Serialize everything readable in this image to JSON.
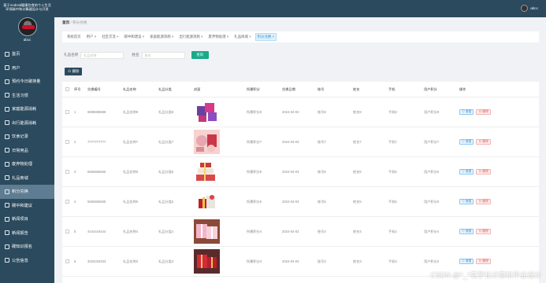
{
  "sidebar": {
    "title": "基于Android健康饮食的个人生活环保碳中和计算器设计与开发",
    "username": "abcc",
    "items": [
      {
        "label": "首页",
        "icon": "home-icon",
        "active": false
      },
      {
        "label": "用户",
        "icon": "user-icon",
        "active": false
      },
      {
        "label": "预约今日碳排量",
        "icon": "calendar-icon",
        "active": false
      },
      {
        "label": "生活习惯",
        "icon": "list-icon",
        "active": false
      },
      {
        "label": "家庭能源消耗",
        "icon": "home-energy-icon",
        "active": false
      },
      {
        "label": "出行能源消耗",
        "icon": "car-icon",
        "active": false
      },
      {
        "label": "饮食记录",
        "icon": "food-icon",
        "active": false
      },
      {
        "label": "日常用品",
        "icon": "bag-icon",
        "active": false
      },
      {
        "label": "废弃物处理",
        "icon": "trash-icon",
        "active": false
      },
      {
        "label": "礼品商城",
        "icon": "gift-icon",
        "active": false
      },
      {
        "label": "积分兑换",
        "icon": "exchange-icon",
        "active": true
      },
      {
        "label": "碳中和建议",
        "icon": "leaf-icon",
        "active": false
      },
      {
        "label": "新闻项目",
        "icon": "news-icon",
        "active": false
      },
      {
        "label": "新闻报告",
        "icon": "report-icon",
        "active": false
      },
      {
        "label": "碳知识报名",
        "icon": "signup-icon",
        "active": false
      },
      {
        "label": "公告信息",
        "icon": "notice-icon",
        "active": false
      }
    ]
  },
  "header": {
    "username": "abcc"
  },
  "breadcrumb": {
    "home": "首页",
    "current": "积分兑换"
  },
  "tags": [
    {
      "label": "系统首页",
      "active": false
    },
    {
      "label": "用户 ×",
      "active": false
    },
    {
      "label": "社区交流 ×",
      "active": false
    },
    {
      "label": "碳中和建议 ×",
      "active": false
    },
    {
      "label": "家庭能源消耗 ×",
      "active": false
    },
    {
      "label": "出行能源消耗 ×",
      "active": false
    },
    {
      "label": "废弃物处理 ×",
      "active": false
    },
    {
      "label": "礼品商城 ×",
      "active": false
    },
    {
      "label": "积分兑换 ×",
      "active": true
    }
  ],
  "search": {
    "label1": "礼品名称",
    "placeholder1": "礼品名称",
    "label2": "姓名",
    "placeholder2": "姓名",
    "button": "查询"
  },
  "delete_button": "删除",
  "table": {
    "headers": [
      "",
      "序号",
      "兑换编号",
      "礼品名称",
      "礼品分类",
      "封面",
      "所需积分",
      "兑换日期",
      "账号",
      "姓名",
      "手机",
      "用户积分",
      "操作"
    ],
    "view_label": "查看",
    "delete_label": "删除",
    "rows": [
      {
        "no": "1",
        "code": "8888888888",
        "name": "礼品名称8",
        "cat": "礼品分类8",
        "img": "purple",
        "points": "所需积分8",
        "date": "2024-04-03",
        "account": "账号8",
        "person": "姓名8",
        "phone": "手机8",
        "upoints": "用户积分8"
      },
      {
        "no": "2",
        "code": "7777777777",
        "name": "礼品名称7",
        "cat": "礼品分类7",
        "img": "pink",
        "points": "所需积分7",
        "date": "2024-04-03",
        "account": "账号7",
        "person": "姓名7",
        "phone": "手机7",
        "upoints": "用户积分7"
      },
      {
        "no": "3",
        "code": "6666666666",
        "name": "礼品名称6",
        "cat": "礼品分类6",
        "img": "stack",
        "points": "所需积分6",
        "date": "2024-04-03",
        "account": "账号6",
        "person": "姓名6",
        "phone": "手机6",
        "upoints": "用户积分6"
      },
      {
        "no": "4",
        "code": "5555555555",
        "name": "礼品名称5",
        "cat": "礼品分类5",
        "img": "red",
        "points": "所需积分5",
        "date": "2024-04-03",
        "account": "账号5",
        "person": "姓名5",
        "phone": "手机5",
        "upoints": "用户积分5"
      },
      {
        "no": "5",
        "code": "4444444444",
        "name": "礼品名称4",
        "cat": "礼品分类4",
        "img": "pinkbox",
        "points": "所需积分4",
        "date": "2024-04-03",
        "account": "账号4",
        "person": "姓名4",
        "phone": "手机4",
        "upoints": "用户积分4"
      },
      {
        "no": "6",
        "code": "3333333333",
        "name": "礼品名称3",
        "cat": "礼品分类3",
        "img": "redbox",
        "points": "所需积分3",
        "date": "2024-04-03",
        "account": "账号3",
        "person": "姓名3",
        "phone": "手机3",
        "upoints": "用户积分3"
      }
    ]
  },
  "watermark": "CSDN @^_^花学长计算机毕业设计"
}
